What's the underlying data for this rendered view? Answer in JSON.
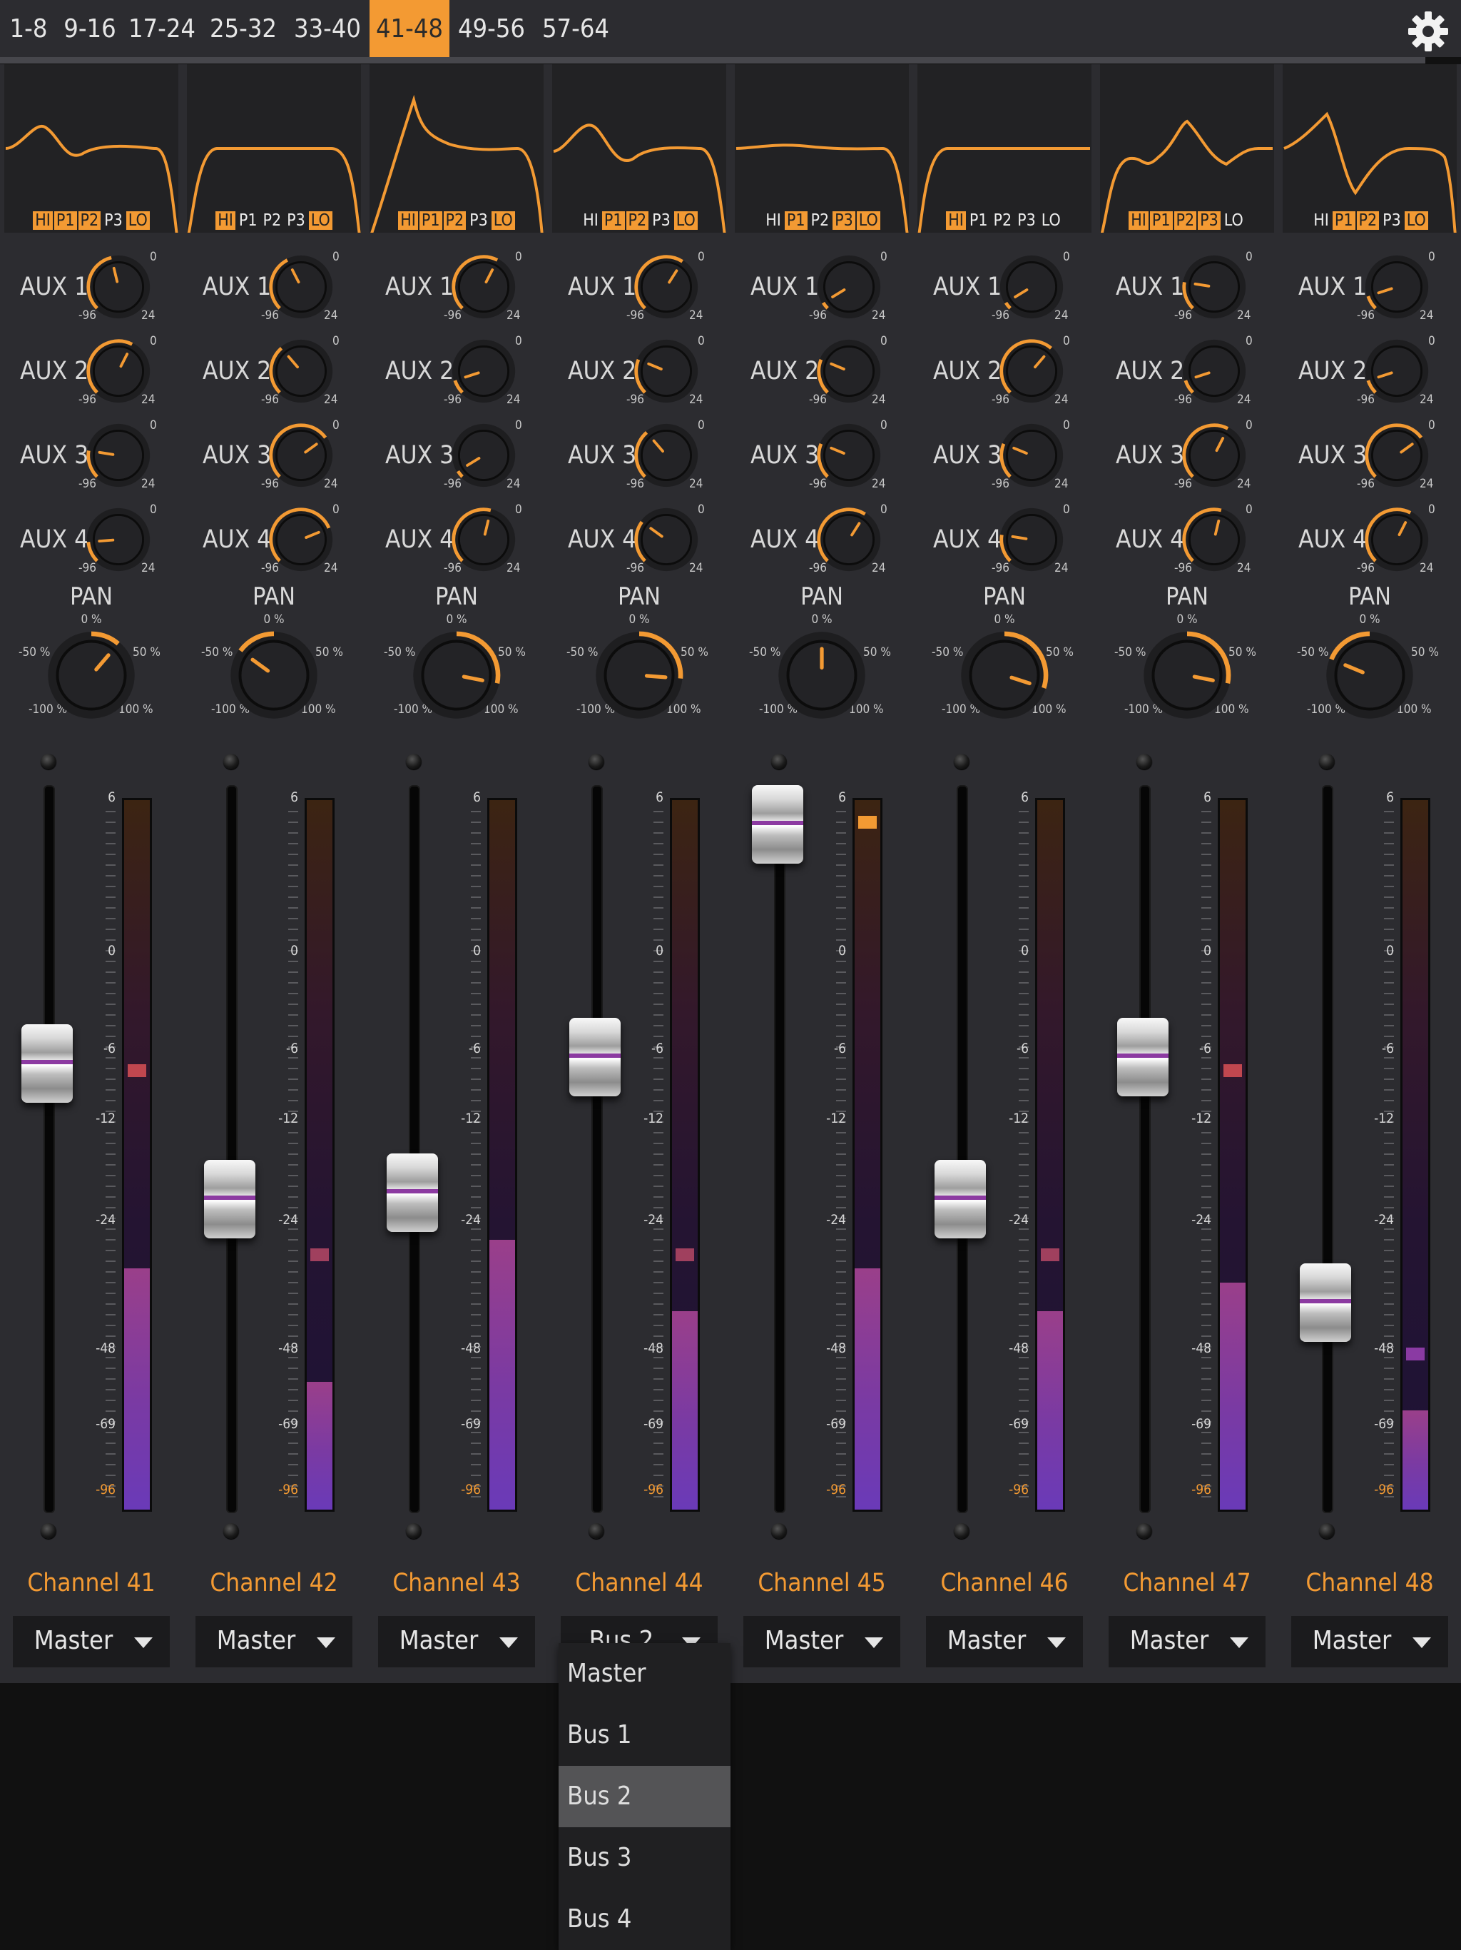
{
  "tabs": [
    {
      "label": "1-8",
      "active": false
    },
    {
      "label": "9-16",
      "active": false
    },
    {
      "label": "17-24",
      "active": false
    },
    {
      "label": "25-32",
      "active": false
    },
    {
      "label": "33-40",
      "active": false
    },
    {
      "label": "41-48",
      "active": true
    },
    {
      "label": "49-56",
      "active": false
    },
    {
      "label": "57-64",
      "active": false
    }
  ],
  "settings_icon": "gear-icon",
  "colors": {
    "accent": "#f39a33",
    "panel": "#2c2c30",
    "meter": "#7a3aa3",
    "peak_red": "#c0474f",
    "peak_orange": "#f39a33"
  },
  "aux_labels": [
    "AUX 1",
    "AUX 2",
    "AUX 3",
    "AUX 4"
  ],
  "aux_range": {
    "min": "-96",
    "max": "24",
    "zero": "0"
  },
  "pan": {
    "label": "PAN",
    "center": "0 %",
    "l50": "-50 %",
    "r50": "50 %",
    "l100": "-100 %",
    "r100": "100 %"
  },
  "meter_scale": [
    "6",
    "0",
    "-6",
    "-12",
    "-24",
    "-48",
    "-69",
    "-96"
  ],
  "eq_band_names": [
    "HI",
    "P1",
    "P2",
    "P3",
    "LO"
  ],
  "channels": [
    {
      "name": "Channel 41",
      "output": "Master",
      "eq_bands": [
        true,
        true,
        true,
        false,
        true
      ],
      "aux": [
        0.45,
        0.6,
        0.2,
        0.15
      ],
      "pan": 0.3,
      "fader": 0.63,
      "meter": 0.34,
      "peak": 0.61,
      "peak_color": "#c0474f"
    },
    {
      "name": "Channel 42",
      "output": "Master",
      "eq_bands": [
        true,
        false,
        false,
        false,
        true
      ],
      "aux": [
        0.4,
        0.35,
        0.7,
        0.75
      ],
      "pan": -0.4,
      "fader": 0.42,
      "meter": 0.18,
      "peak": 0.35,
      "peak_color": "#a0405e"
    },
    {
      "name": "Channel 43",
      "output": "Master",
      "eq_bands": [
        true,
        true,
        true,
        false,
        true
      ],
      "aux": [
        0.6,
        0.1,
        0.05,
        0.55
      ],
      "pan": 0.75,
      "fader": 0.43,
      "meter": 0.38,
      "peak": null,
      "peak_color": ""
    },
    {
      "name": "Channel 44",
      "output": "Bus 2",
      "eq_bands": [
        false,
        true,
        true,
        false,
        true
      ],
      "aux": [
        0.62,
        0.25,
        0.35,
        0.3
      ],
      "pan": 0.7,
      "fader": 0.64,
      "meter": 0.28,
      "peak": 0.35,
      "peak_color": "#a0405e"
    },
    {
      "name": "Channel 45",
      "output": "Master",
      "eq_bands": [
        false,
        true,
        false,
        true,
        true
      ],
      "aux": [
        0.05,
        0.25,
        0.25,
        0.62
      ],
      "pan": 0.0,
      "fader": 1.0,
      "meter": 0.34,
      "peak": 0.96,
      "peak_color": "#f39a33"
    },
    {
      "name": "Channel 46",
      "output": "Master",
      "eq_bands": [
        true,
        false,
        false,
        false,
        false
      ],
      "aux": [
        0.05,
        0.65,
        0.25,
        0.2
      ],
      "pan": 0.8,
      "fader": 0.42,
      "meter": 0.28,
      "peak": 0.35,
      "peak_color": "#a0405e"
    },
    {
      "name": "Channel 47",
      "output": "Master",
      "eq_bands": [
        true,
        true,
        true,
        true,
        false
      ],
      "aux": [
        0.2,
        0.1,
        0.6,
        0.55
      ],
      "pan": 0.75,
      "fader": 0.64,
      "meter": 0.32,
      "peak": 0.61,
      "peak_color": "#c0474f"
    },
    {
      "name": "Channel 48",
      "output": "Master",
      "eq_bands": [
        false,
        true,
        true,
        false,
        true
      ],
      "aux": [
        0.1,
        0.1,
        0.7,
        0.6
      ],
      "pan": -0.5,
      "fader": 0.26,
      "meter": 0.14,
      "peak": 0.21,
      "peak_color": "#8a3aa3"
    }
  ],
  "output_menu": {
    "items": [
      "Master",
      "Bus 1",
      "Bus 2",
      "Bus 3",
      "Bus 4"
    ],
    "selected": "Bus 2",
    "open_for": "Channel 44"
  }
}
